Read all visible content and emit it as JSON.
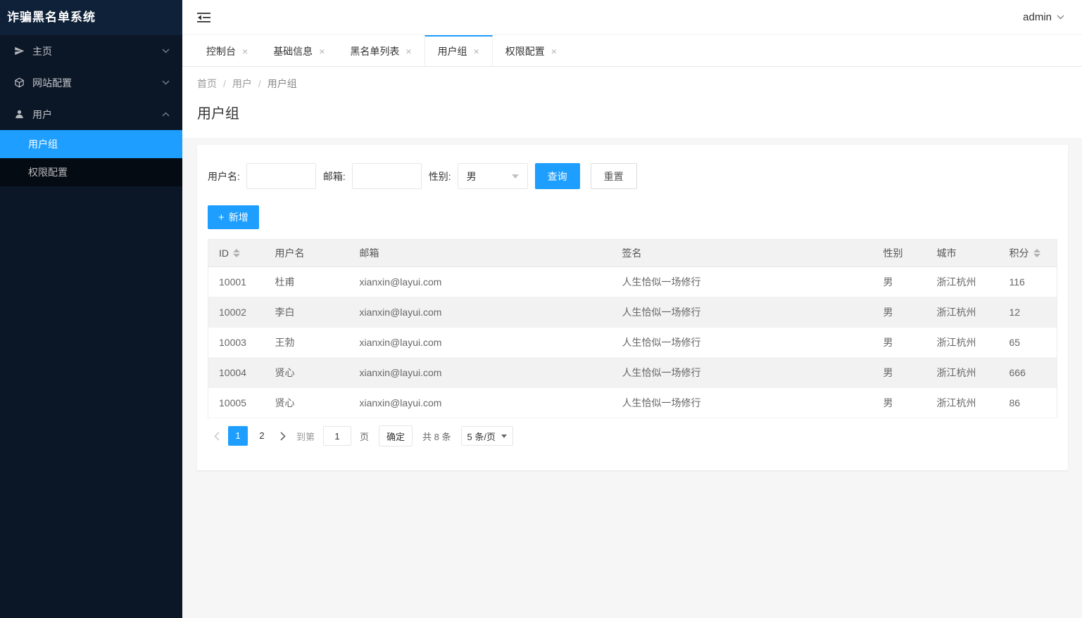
{
  "app": {
    "title": "诈骗黑名单系统"
  },
  "header": {
    "user": "admin"
  },
  "icons": {
    "close": "×",
    "plus": "+"
  },
  "sidebar": {
    "items": [
      {
        "label": "主页",
        "icon": "send-icon"
      },
      {
        "label": "网站配置",
        "icon": "cube-icon"
      },
      {
        "label": "用户",
        "icon": "user-icon",
        "expanded": true
      }
    ],
    "submenu": [
      {
        "label": "用户组",
        "active": true
      },
      {
        "label": "权限配置",
        "active": false
      }
    ]
  },
  "tabs": [
    {
      "label": "控制台",
      "active": false
    },
    {
      "label": "基础信息",
      "active": false
    },
    {
      "label": "黑名单列表",
      "active": false
    },
    {
      "label": "用户组",
      "active": true
    },
    {
      "label": "权限配置",
      "active": false
    }
  ],
  "breadcrumb": {
    "items": [
      "首页",
      "用户",
      "用户组"
    ],
    "separator": "/"
  },
  "page": {
    "title": "用户组"
  },
  "filter": {
    "username_label": "用户名:",
    "email_label": "邮箱:",
    "gender_label": "性别:",
    "gender_value": "男",
    "search_button": "查询",
    "reset_button": "重置",
    "add_button": "新增"
  },
  "table": {
    "columns": [
      "ID",
      "用户名",
      "邮箱",
      "签名",
      "性别",
      "城市",
      "积分"
    ],
    "rows": [
      [
        "10001",
        "杜甫",
        "xianxin@layui.com",
        "人生恰似一场修行",
        "男",
        "浙江杭州",
        "116"
      ],
      [
        "10002",
        "李白",
        "xianxin@layui.com",
        "人生恰似一场修行",
        "男",
        "浙江杭州",
        "12"
      ],
      [
        "10003",
        "王勃",
        "xianxin@layui.com",
        "人生恰似一场修行",
        "男",
        "浙江杭州",
        "65"
      ],
      [
        "10004",
        "贤心",
        "xianxin@layui.com",
        "人生恰似一场修行",
        "男",
        "浙江杭州",
        "666"
      ],
      [
        "10005",
        "贤心",
        "xianxin@layui.com",
        "人生恰似一场修行",
        "男",
        "浙江杭州",
        "86"
      ]
    ]
  },
  "pagination": {
    "pages": [
      {
        "label": "1",
        "active": true
      },
      {
        "label": "2",
        "active": false
      }
    ],
    "goto_label": "到第",
    "goto_value": "1",
    "page_label": "页",
    "confirm_label": "确定",
    "total_label": "共 8 条",
    "per_page": "5 条/页"
  },
  "colors": {
    "accent": "#1E9FFF",
    "sidebar_bg": "#0b1626",
    "stripe": "#f2f2f2"
  }
}
